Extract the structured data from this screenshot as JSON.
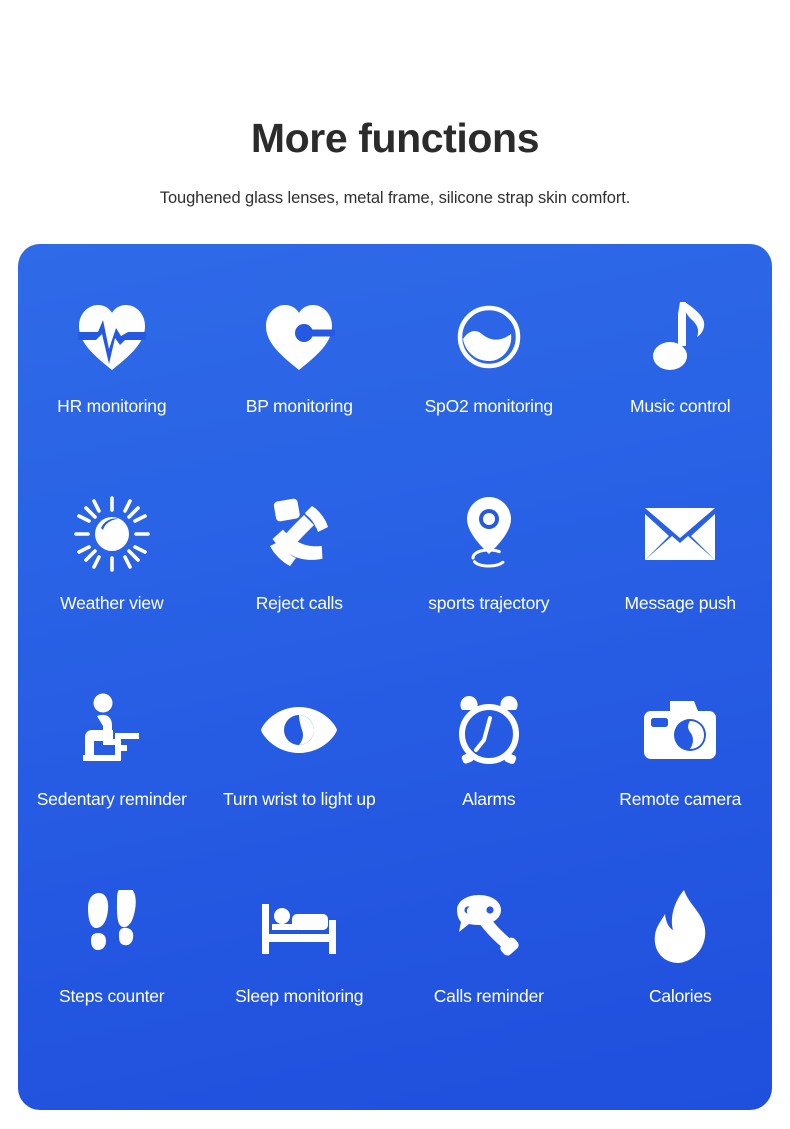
{
  "header": {
    "title": "More functions",
    "subtitle": "Toughened glass lenses, metal frame, silicone strap skin comfort."
  },
  "colors": {
    "panel_blue_top": "#2f6ae8",
    "panel_blue_bottom": "#1f4fdd",
    "icon_white": "#ffffff",
    "title_dark": "#2b2b2b",
    "page_background": "#ffffff"
  },
  "panel": {
    "rows": 4,
    "columns": 4,
    "features": [
      {
        "icon": "heart-pulse-icon",
        "label": "HR monitoring"
      },
      {
        "icon": "heart-gauge-icon",
        "label": "BP monitoring"
      },
      {
        "icon": "blood-oxygen-icon",
        "label": "SpO2 monitoring"
      },
      {
        "icon": "music-note-icon",
        "label": "Music control"
      },
      {
        "icon": "sun-icon",
        "label": "Weather view"
      },
      {
        "icon": "phone-handset-icon",
        "label": "Reject calls"
      },
      {
        "icon": "map-pin-icon",
        "label": "sports trajectory"
      },
      {
        "icon": "envelope-icon",
        "label": "Message push"
      },
      {
        "icon": "person-sitting-icon",
        "label": "Sedentary reminder"
      },
      {
        "icon": "eye-icon",
        "label": "Turn wrist to light up"
      },
      {
        "icon": "alarm-clock-icon",
        "label": "Alarms"
      },
      {
        "icon": "camera-icon",
        "label": "Remote camera"
      },
      {
        "icon": "footprints-icon",
        "label": "Steps counter"
      },
      {
        "icon": "bed-sleep-icon",
        "label": "Sleep monitoring"
      },
      {
        "icon": "phone-chat-icon",
        "label": "Calls reminder"
      },
      {
        "icon": "flame-icon",
        "label": "Calories"
      }
    ]
  }
}
